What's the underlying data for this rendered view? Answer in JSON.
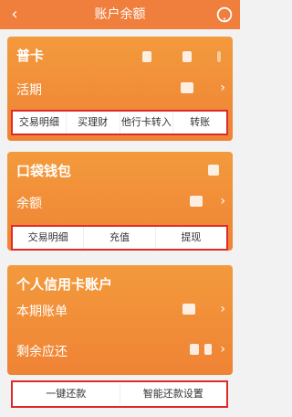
{
  "header": {
    "title": "账户余额",
    "back_icon": "chevron-left-icon",
    "help_icon": "headset-icon"
  },
  "cards": {
    "card1": {
      "title": "普卡",
      "row_label": "活期",
      "actions": [
        "交易明细",
        "买理财",
        "他行卡转入",
        "转账"
      ]
    },
    "card2": {
      "title": "口袋钱包",
      "row_label": "余额",
      "actions": [
        "交易明细",
        "充值",
        "提现"
      ]
    },
    "card3": {
      "title": "个人信用卡账户",
      "row1_label": "本期账单",
      "row2_label": "剩余应还",
      "actions": [
        "一键还款",
        "智能还款设置"
      ]
    }
  },
  "colors": {
    "orange": "#f07e3c",
    "highlight_red": "#e02a2a"
  }
}
